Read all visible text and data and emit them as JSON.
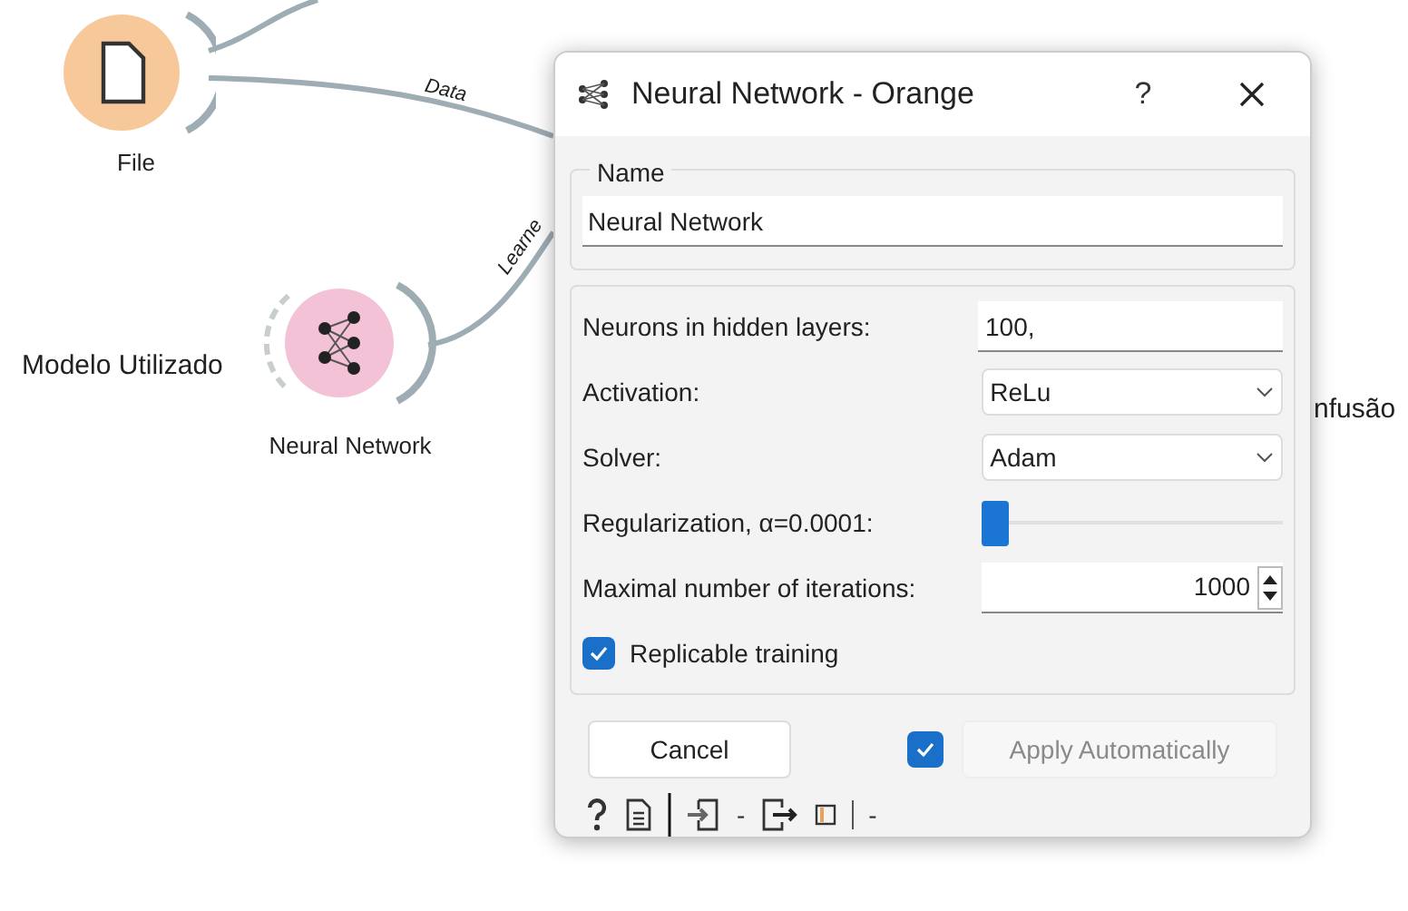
{
  "canvas": {
    "nodes": [
      {
        "kind": "file",
        "label": "File"
      },
      {
        "kind": "neural",
        "label": "Neural Network"
      }
    ],
    "link_labels": [
      "Data",
      "Learne"
    ],
    "annotation": "Modelo Utilizado",
    "partial_label": "nfusão"
  },
  "dialog": {
    "title": "Neural Network - Orange",
    "help": "?",
    "name_group": {
      "title": "Name",
      "value": "Neural Network"
    },
    "params": [
      {
        "kind": "text",
        "label": "Neurons in hidden layers:",
        "value": "100,"
      },
      {
        "kind": "combo",
        "label": "Activation:",
        "value": "ReLu"
      },
      {
        "kind": "combo",
        "label": "Solver:",
        "value": "Adam"
      },
      {
        "kind": "slider",
        "label": "Regularization, α=0.0001:",
        "level": 0
      },
      {
        "kind": "spin",
        "label": "Maximal number of iterations:",
        "value": "1000"
      },
      {
        "kind": "checkbox",
        "label": "Replicable training",
        "checked": true
      }
    ],
    "cancel": "Cancel",
    "auto_apply": {
      "label": "Apply Automatically",
      "checked": true,
      "disabled": true
    },
    "status_dashes": [
      "-",
      "-"
    ]
  }
}
